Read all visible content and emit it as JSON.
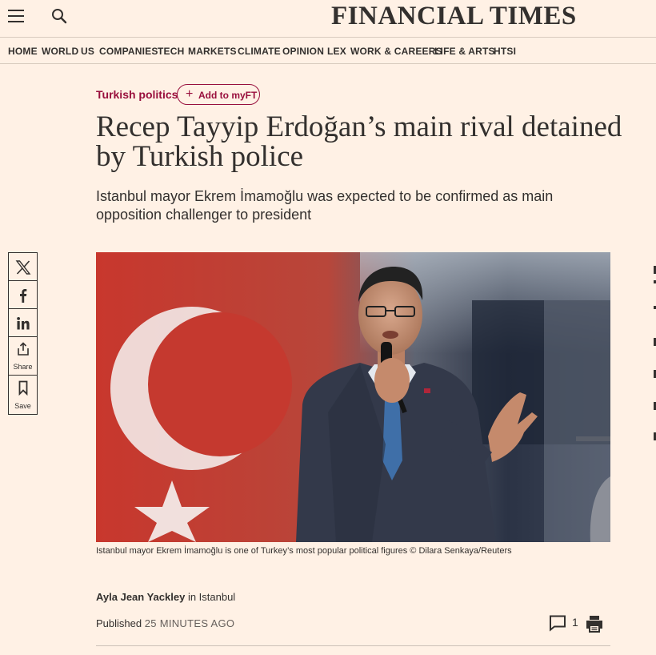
{
  "header": {
    "logo": "FINANCIAL TIMES",
    "menu_icon": "hamburger-menu-icon",
    "search_icon": "search-icon"
  },
  "nav": {
    "items": [
      "HOME",
      "WORLD",
      "US",
      "COMPANIES",
      "TECH",
      "MARKETS",
      "CLIMATE",
      "OPINION",
      "LEX",
      "WORK & CAREERS",
      "LIFE & ARTS",
      "HTSI"
    ]
  },
  "article": {
    "topic": "Turkish politics",
    "add_myft": "Add to myFT",
    "headline": "Recep Tayyip Erdoğan’s main rival detained by Turkish police",
    "standfirst": "Istanbul mayor Ekrem İmamoğlu was expected to be confirmed as main opposition challenger to president",
    "caption": "Istanbul mayor Ekrem İmamoğlu is one of Turkey’s most popular political figures © Dilara Senkaya/Reuters",
    "author": "Ayla Jean Yackley",
    "location": "in Istanbul",
    "published_label": "Published",
    "published_time": "25 MINUTES AGO",
    "comment_count": "1"
  },
  "share": {
    "share_label": "Share",
    "save_label": "Save"
  },
  "colors": {
    "background": "#FFF1E5",
    "claret": "#990F3D",
    "text": "#33302E",
    "flag_red": "#C8372D"
  }
}
